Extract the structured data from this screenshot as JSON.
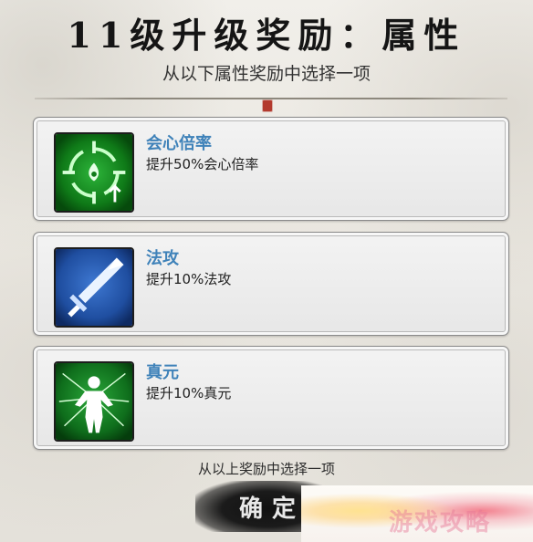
{
  "header": {
    "title": "11级升级奖励：属性",
    "subtitle": "从以下属性奖励中选择一项"
  },
  "options": [
    {
      "name": "会心倍率",
      "description": "提升50%会心倍率",
      "icon": "crit-multiplier-icon"
    },
    {
      "name": "法攻",
      "description": "提升10%法攻",
      "icon": "sword-icon"
    },
    {
      "name": "真元",
      "description": "提升10%真元",
      "icon": "figure-energy-icon"
    }
  ],
  "footer": {
    "hint": "从以上奖励中选择一项",
    "confirm_label": "确定"
  },
  "watermark": "游戏攻略",
  "colors": {
    "option_name": "#3f82b9",
    "icon_green": "#0f7a18",
    "icon_blue": "#1f4ea0"
  }
}
